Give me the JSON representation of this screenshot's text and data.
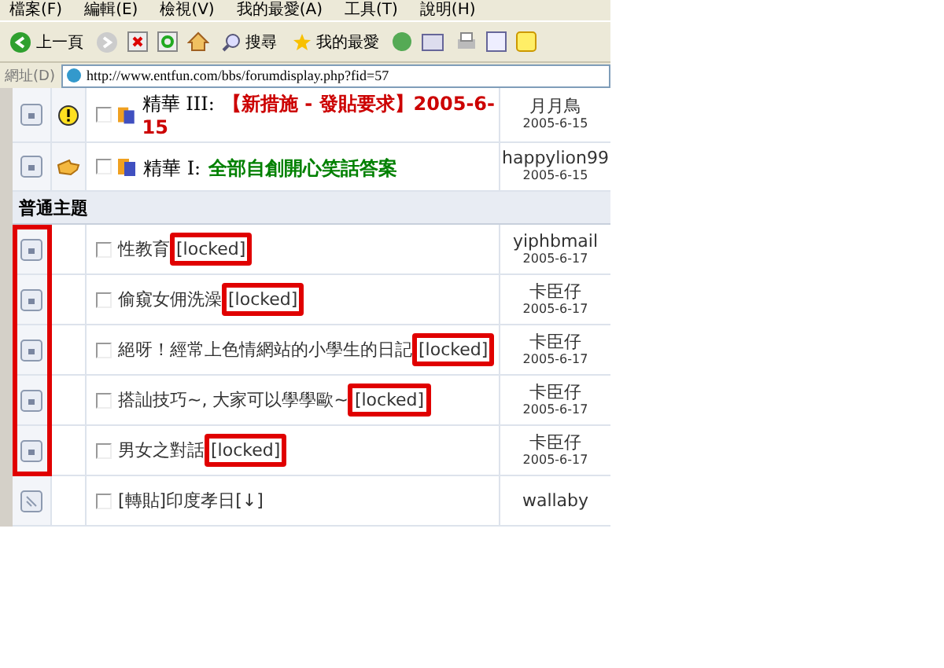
{
  "menu_bar": [
    "檔案(F)",
    "編輯(E)",
    "檢視(V)",
    "我的最愛(A)",
    "工具(T)",
    "說明(H)"
  ],
  "toolbar": {
    "back": "上一頁",
    "search": "搜尋",
    "favorites": "我的最愛"
  },
  "address_bar": {
    "label": "網址(D)",
    "url": "http://www.entfun.com/bbs/forumdisplay.php?fid=57"
  },
  "sticky_threads": [
    {
      "kind": "alert",
      "prefix": "精華 III:",
      "title": "【新措施 - 發貼要求】2005-6-15",
      "color": "#cc0000",
      "checked": false,
      "author": "月月鳥",
      "date": "2005-6-15"
    },
    {
      "kind": "hand",
      "prefix": "精華 I:",
      "title": "全部自創開心笑話答案",
      "color": "#008000",
      "checked": false,
      "author": "happylion99",
      "date": "2005-6-15"
    }
  ],
  "section_header": "普通主題",
  "lock_column_highlighted": true,
  "threads": [
    {
      "title": "性教育",
      "tag": "[locked]",
      "highlighted": true,
      "locked": true,
      "checked": false,
      "author": "yiphbmail",
      "date": "2005-6-17"
    },
    {
      "title": "偷窺女佣洗澡",
      "tag": "[locked]",
      "highlighted": true,
      "locked": true,
      "checked": false,
      "author": "卡臣仔",
      "date": "2005-6-17"
    },
    {
      "title": "絕呀！經常上色情網站的小學生的日記",
      "tag": "[locked]",
      "highlighted": true,
      "locked": true,
      "checked": false,
      "author": "卡臣仔",
      "date": "2005-6-17"
    },
    {
      "title": "搭訕技巧~, 大家可以學學歐~",
      "tag": "[locked]",
      "highlighted": true,
      "locked": true,
      "checked": false,
      "author": "卡臣仔",
      "date": "2005-6-17"
    },
    {
      "title": "男女之對話",
      "tag": "[locked]",
      "highlighted": true,
      "locked": true,
      "checked": false,
      "author": "卡臣仔",
      "date": "2005-6-17"
    },
    {
      "title": "[轉貼]印度孝日[↓]",
      "locked": false,
      "checked": false,
      "author": "wallaby"
    }
  ]
}
